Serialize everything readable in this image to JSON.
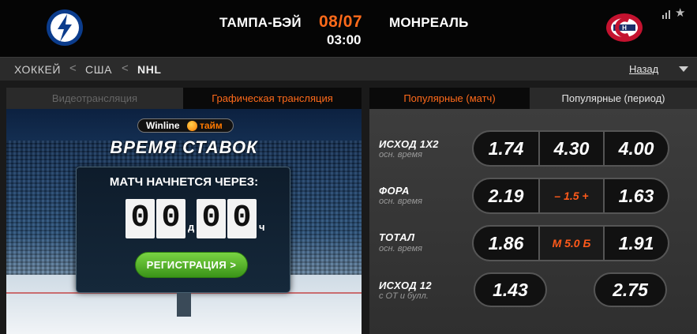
{
  "header": {
    "team_home": "ТАМПА-БЭЙ",
    "team_away": "МОНРЕАЛЬ",
    "date": "08/07",
    "time": "03:00",
    "accent_color": "#ff6a1a",
    "icons": {
      "home_logo": "tampa-bay-lightning-logo",
      "away_logo": "montreal-canadiens-logo",
      "stats": "bar-chart-icon",
      "favorite": "star-icon"
    },
    "star_glyph": "★"
  },
  "breadcrumb": {
    "items": [
      "ХОККЕЙ",
      "США",
      "NHL"
    ],
    "separator": "<",
    "back_label": "Назад"
  },
  "left_panel": {
    "tabs": [
      "Видеотрансляция",
      "Графическая трансляция"
    ],
    "active_tab": 1,
    "brand_word1": "Winline",
    "brand_word2": "тайм",
    "title": "ВРЕМЯ СТАВОК",
    "countdown_title": "МАТЧ НАЧНЕТСЯ ЧЕРЕЗ:",
    "days_digits": "00",
    "days_unit": "д",
    "hours_digits": "00",
    "hours_unit": "ч",
    "register_button": "РЕГИСТРАЦИЯ >"
  },
  "right_panel": {
    "tabs": [
      "Популярные (матч)",
      "Популярные (период)"
    ],
    "active_tab": 0,
    "markets": [
      {
        "label": "ИСХОД 1Х2",
        "sub": "осн. время",
        "odds": [
          "1.74",
          "4.30",
          "4.00"
        ]
      },
      {
        "label": "ФОРА",
        "sub": "осн. время",
        "odds": [
          "2.19",
          "– 1.5 +",
          "1.63"
        ]
      },
      {
        "label": "ТОТАЛ",
        "sub": "осн. время",
        "odds": [
          "1.86",
          "М 5.0 Б",
          "1.91"
        ]
      },
      {
        "label": "ИСХОД 12",
        "sub": "с ОТ и булл.",
        "odds": [
          "1.43",
          "2.75"
        ]
      }
    ]
  }
}
